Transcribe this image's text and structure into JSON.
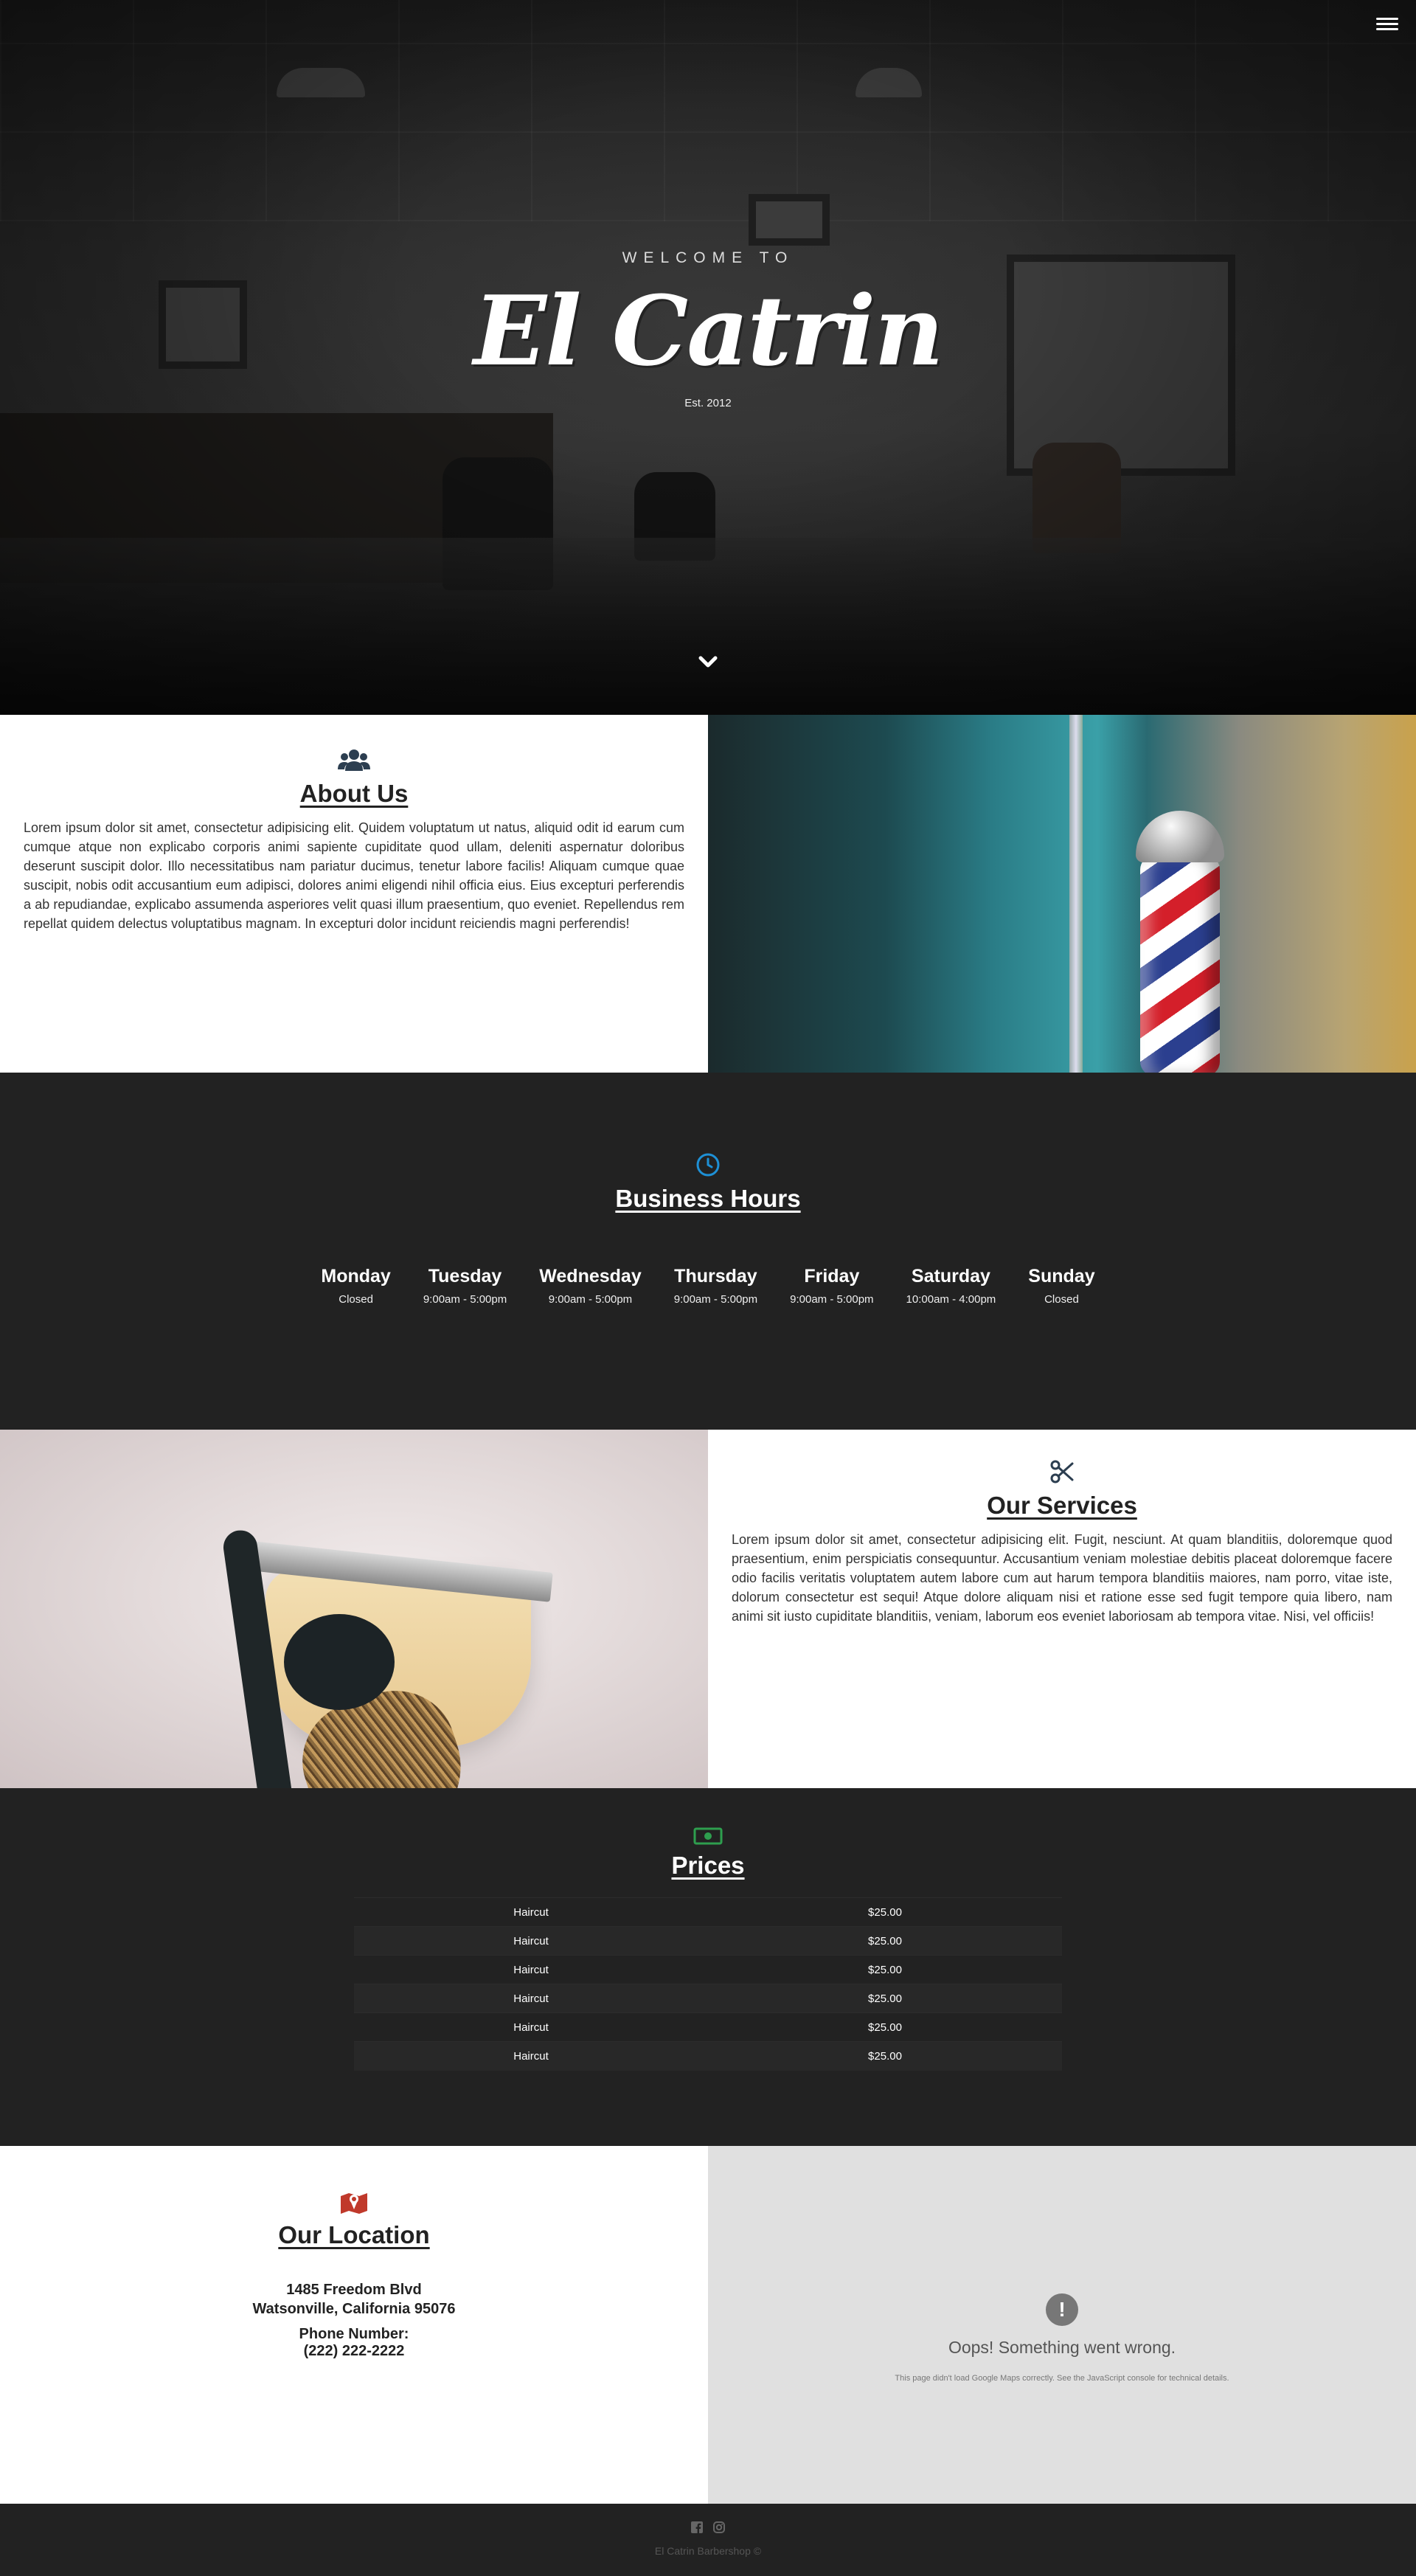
{
  "hero": {
    "welcome": "WELCOME TO",
    "brand_first": "El",
    "brand_second": "Catrin",
    "est": "Est. 2012"
  },
  "about": {
    "title": "About Us",
    "body": "Lorem ipsum dolor sit amet, consectetur adipisicing elit. Quidem voluptatum ut natus, aliquid odit id earum cum cumque atque non explicabo corporis animi sapiente cupiditate quod ullam, deleniti aspernatur doloribus deserunt suscipit dolor. Illo necessitatibus nam pariatur ducimus, tenetur labore facilis! Aliquam cumque quae suscipit, nobis odit accusantium eum adipisci, dolores animi eligendi nihil officia eius. Eius excepturi perferendis a ab repudiandae, explicabo assumenda asperiores velit quasi illum praesentium, quo eveniet. Repellendus rem repellat quidem delectus voluptatibus magnam. In excepturi dolor incidunt reiciendis magni perferendis!"
  },
  "hours": {
    "title": "Business Hours",
    "days": [
      {
        "name": "Monday",
        "time": "Closed"
      },
      {
        "name": "Tuesday",
        "time": "9:00am - 5:00pm"
      },
      {
        "name": "Wednesday",
        "time": "9:00am - 5:00pm"
      },
      {
        "name": "Thursday",
        "time": "9:00am - 5:00pm"
      },
      {
        "name": "Friday",
        "time": "9:00am - 5:00pm"
      },
      {
        "name": "Saturday",
        "time": "10:00am - 4:00pm"
      },
      {
        "name": "Sunday",
        "time": "Closed"
      }
    ]
  },
  "services": {
    "title": "Our Services",
    "body": "Lorem ipsum dolor sit amet, consectetur adipisicing elit. Fugit, nesciunt. At quam blanditiis, doloremque quod praesentium, enim perspiciatis consequuntur. Accusantium veniam molestiae debitis placeat doloremque facere odio facilis veritatis voluptatem autem labore cum aut harum tempora blanditiis maiores, nam porro, vitae iste, dolorum consectetur est sequi! Atque dolore aliquam nisi et ratione esse sed fugit tempore quia libero, nam animi sit iusto cupiditate blanditiis, veniam, laborum eos eveniet laboriosam ab tempora vitae. Nisi, vel officiis!"
  },
  "prices": {
    "title": "Prices",
    "rows": [
      {
        "service": "Haircut",
        "price": "$25.00"
      },
      {
        "service": "Haircut",
        "price": "$25.00"
      },
      {
        "service": "Haircut",
        "price": "$25.00"
      },
      {
        "service": "Haircut",
        "price": "$25.00"
      },
      {
        "service": "Haircut",
        "price": "$25.00"
      },
      {
        "service": "Haircut",
        "price": "$25.00"
      }
    ]
  },
  "location": {
    "title": "Our Location",
    "address_line1": "1485 Freedom Blvd",
    "address_line2": "Watsonville, California 95076",
    "phone_label": "Phone Number:",
    "phone": "(222) 222-2222"
  },
  "map": {
    "error_icon": "!",
    "error_title": "Oops! Something went wrong.",
    "error_desc": "This page didn't load Google Maps correctly. See the JavaScript console for technical details."
  },
  "footer": {
    "copyright": "El Catrin Barbershop ©"
  },
  "icons": {
    "menu": "hamburger-icon",
    "scroll_down": "chevron-down-icon",
    "about": "users-icon",
    "hours": "clock-icon",
    "services": "scissors-icon",
    "prices": "money-bill-icon",
    "location": "map-marker-icon",
    "facebook": "facebook-icon",
    "instagram": "instagram-icon"
  },
  "colors": {
    "dark_bg": "#222222",
    "hours_icon": "#1e90d6",
    "prices_icon": "#2e9e4e",
    "location_icon": "#c0392b",
    "about_icon": "#2c3e50"
  }
}
